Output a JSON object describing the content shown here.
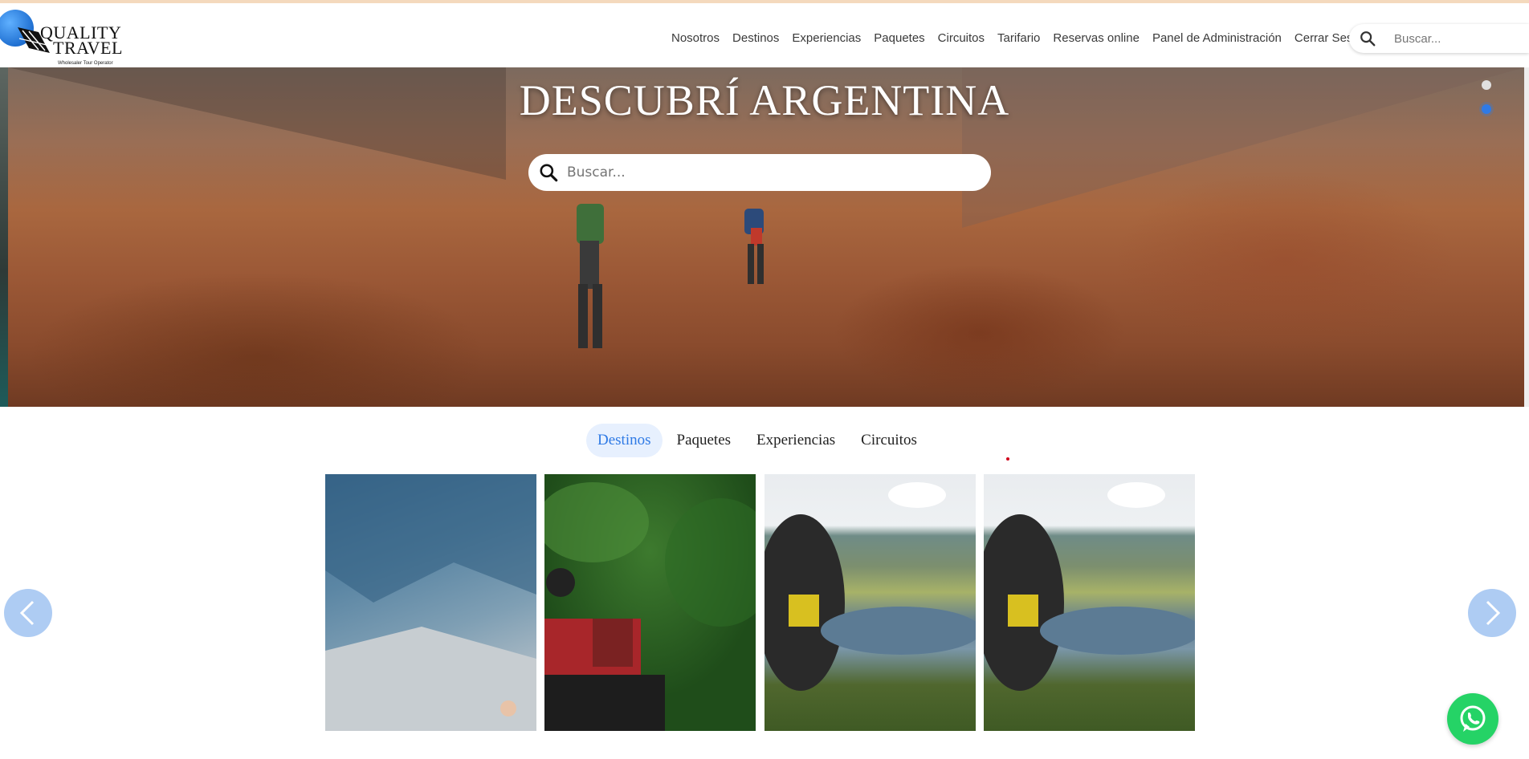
{
  "brand": {
    "word1": "QUALITY",
    "word2": "TRAVEL",
    "tagline": "Wholesaler Tour Operator"
  },
  "nav": {
    "items": [
      {
        "label": "Nosotros"
      },
      {
        "label": "Destinos"
      },
      {
        "label": "Experiencias"
      },
      {
        "label": "Paquetes"
      },
      {
        "label": "Circuitos"
      },
      {
        "label": "Tarifario"
      },
      {
        "label": "Reservas online"
      },
      {
        "label": "Panel de Administración"
      },
      {
        "label": "Cerrar Sesión"
      }
    ],
    "search_placeholder": "Buscar..."
  },
  "hero": {
    "title": "DESCUBRÍ ARGENTINA",
    "search_placeholder": "Buscar...",
    "slides": 2,
    "active_slide": 2
  },
  "tabs": {
    "items": [
      {
        "label": "Destinos",
        "active": true
      },
      {
        "label": "Paquetes",
        "active": false
      },
      {
        "label": "Experiencias",
        "active": false
      },
      {
        "label": "Circuitos",
        "active": false
      }
    ]
  },
  "cards": [
    {
      "image": "mountain-valley-photo"
    },
    {
      "image": "atv-rider-forest-photo"
    },
    {
      "image": "cyclist-lake-photo"
    },
    {
      "image": "cyclist-lake-photo"
    }
  ],
  "colors": {
    "accent": "#2f7ae5",
    "tab_active_bg": "#e7f0fe",
    "whatsapp": "#25d366",
    "topstripe": "#f4d9bd"
  },
  "icons": {
    "search": "search-icon",
    "prev": "chevron-left-icon",
    "next": "chevron-right-icon",
    "chat": "whatsapp-icon"
  }
}
